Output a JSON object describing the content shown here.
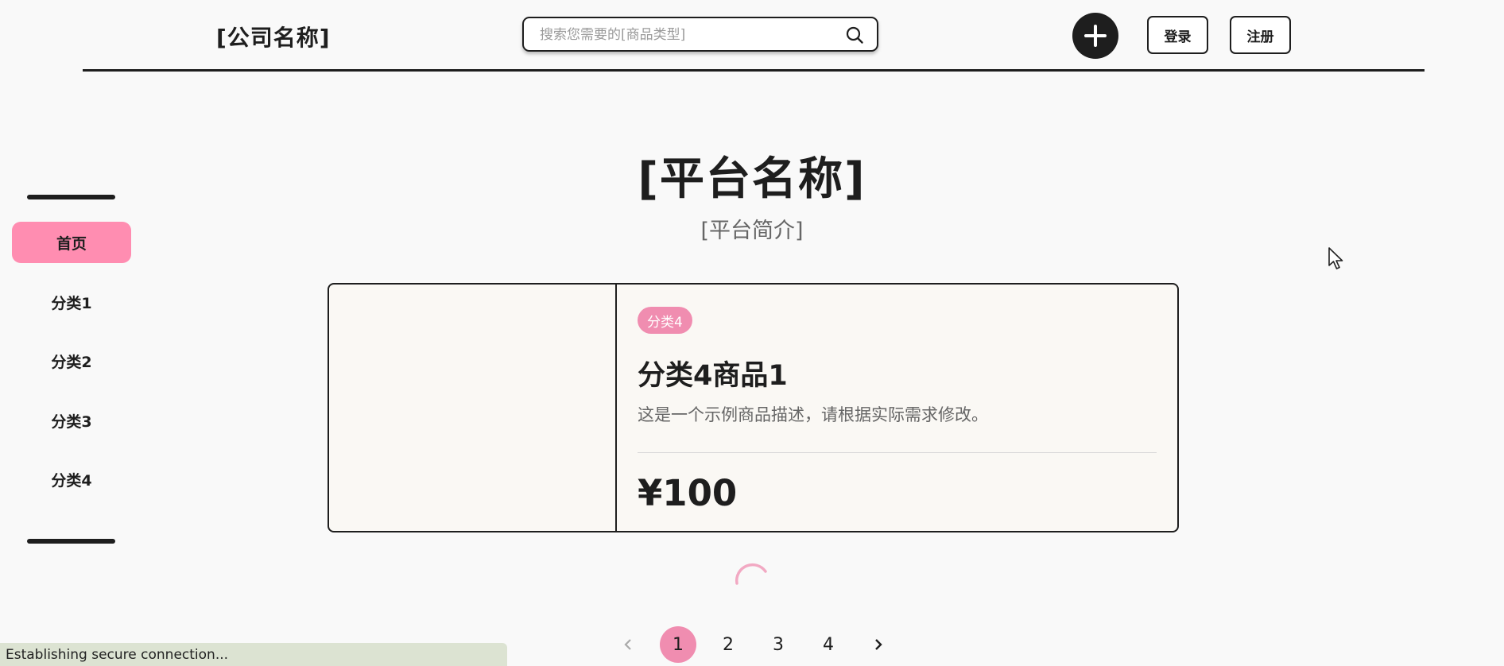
{
  "header": {
    "company_name": "[公司名称]",
    "search_placeholder": "搜索您需要的[商品类型]",
    "login_label": "登录",
    "register_label": "注册"
  },
  "sidebar": {
    "items": [
      {
        "label": "首页",
        "active": true
      },
      {
        "label": "分类1",
        "active": false
      },
      {
        "label": "分类2",
        "active": false
      },
      {
        "label": "分类3",
        "active": false
      },
      {
        "label": "分类4",
        "active": false
      }
    ]
  },
  "hero": {
    "title": "[平台名称]",
    "subtitle": "[平台简介]"
  },
  "product": {
    "category": "分类4",
    "name": "分类4商品1",
    "description": "这是一个示例商品描述，请根据实际需求修改。",
    "price": "¥100"
  },
  "pagination": {
    "pages": [
      "1",
      "2",
      "3",
      "4"
    ],
    "current": "1",
    "prev_icon": "chevron-left-icon",
    "next_icon": "chevron-right-icon"
  },
  "status_bar": {
    "text": "Establishing secure connection..."
  },
  "colors": {
    "accent_pink": "#ff8db1",
    "badge_pink": "#f08db0",
    "dark": "#1e1e1e",
    "background": "#f9f9f9",
    "status_bg": "#dce3d2"
  }
}
